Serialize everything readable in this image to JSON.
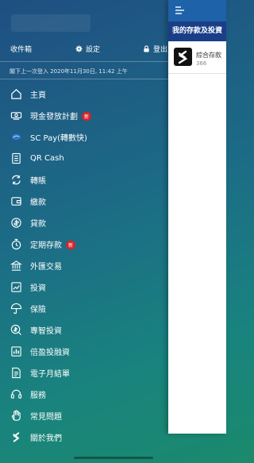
{
  "header": {
    "inbox": "收件箱",
    "settings": "設定",
    "logout": "登出"
  },
  "last_login": "閣下上一次登入 2020年11月30日, 11:42 上午",
  "menu": [
    {
      "label": "主頁",
      "icon": "home-icon"
    },
    {
      "label": "現金發放計劃",
      "icon": "cash-icon",
      "badge": "新"
    },
    {
      "label": "SC Pay(轉數快)",
      "icon": "sc-pay-icon"
    },
    {
      "label": "QR Cash",
      "icon": "qr-cash-icon"
    },
    {
      "label": "轉賬",
      "icon": "transfer-icon"
    },
    {
      "label": "繳款",
      "icon": "payment-icon"
    },
    {
      "label": "貸款",
      "icon": "loan-icon"
    },
    {
      "label": "定期存款",
      "icon": "time-deposit-icon",
      "badge": "新"
    },
    {
      "label": "外匯交易",
      "icon": "fx-icon"
    },
    {
      "label": "投資",
      "icon": "investment-icon"
    },
    {
      "label": "保險",
      "icon": "umbrella-icon"
    },
    {
      "label": "專智投資",
      "icon": "smart-invest-icon"
    },
    {
      "label": "倍盈投融資",
      "icon": "chart-icon"
    },
    {
      "label": "電子月結單",
      "icon": "estatement-icon"
    },
    {
      "label": "服務",
      "icon": "headset-icon"
    },
    {
      "label": "常見問題",
      "icon": "hand-icon"
    },
    {
      "label": "關於我們",
      "icon": "sc-logo-icon"
    }
  ],
  "panel": {
    "title": "我的存款及投資",
    "account_name": "綜合存款",
    "account_number": "366"
  },
  "colors": {
    "panel_header": "#1a3f88",
    "badge": "#d8232a"
  }
}
